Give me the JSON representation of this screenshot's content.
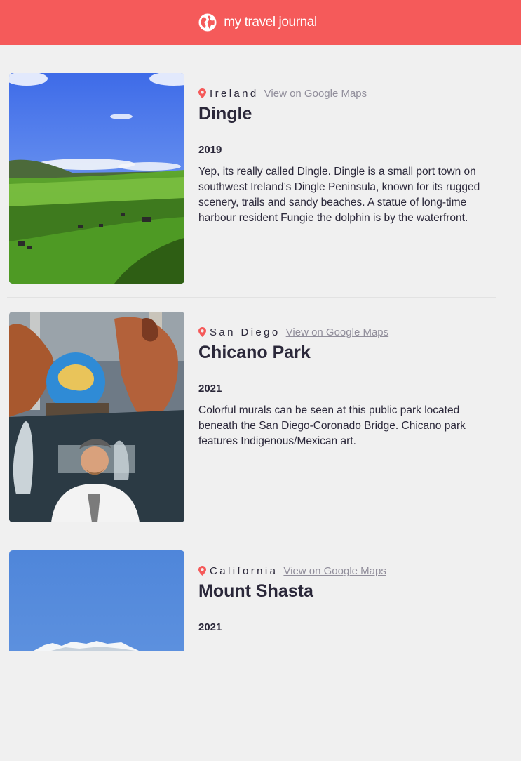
{
  "header": {
    "title": "my travel journal",
    "icon": "globe-icon",
    "bg_color": "#F55A5A"
  },
  "entries": [
    {
      "country": "Ireland",
      "maps_link": "View on Google Maps",
      "place": "Dingle",
      "year": "2019",
      "description": "Yep, its really called Dingle. Dingle is a small port town on southwest Ireland’s Dingle Peninsula, known for its rugged scenery, trails and sandy beaches. A statue of long-time harbour resident Fungie the dolphin is by the waterfront."
    },
    {
      "country": "San Diego",
      "maps_link": "View on Google Maps",
      "place": "Chicano Park",
      "year": "2021",
      "description": "Colorful murals can be seen at this public park located beneath the San Diego-Coronado Bridge. Chicano park features Indigenous/Mexican art."
    },
    {
      "country": "California",
      "maps_link": "View on Google Maps",
      "place": "Mount Shasta",
      "year": "2021",
      "description": ""
    }
  ],
  "colors": {
    "accent": "#F55A5A",
    "text": "#2B283A",
    "muted": "#918E9B",
    "background": "#F0F0F0"
  }
}
